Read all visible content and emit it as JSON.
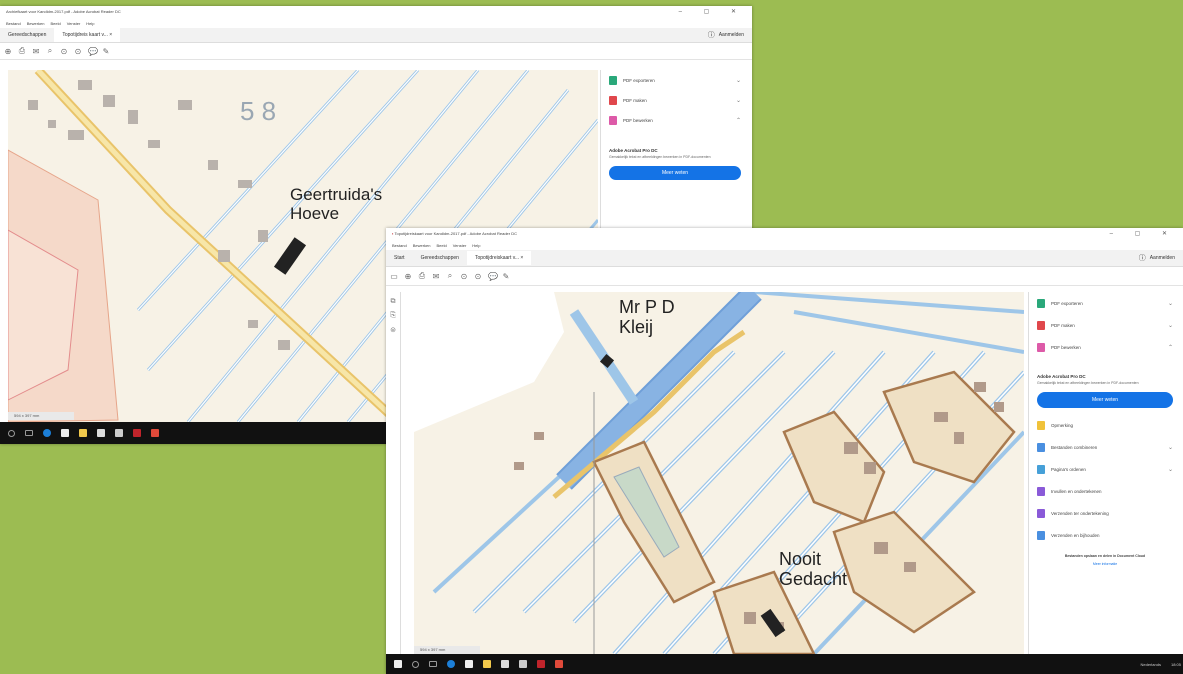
{
  "window1": {
    "title": "Archiefkaart voor Kandidm-2017.pdf - Adobe Acrobat Reader DC",
    "menu": [
      "Bestand",
      "Bewerken",
      "Beeld",
      "Venster",
      "Help"
    ],
    "tabs": [
      "Gereedschappen",
      "Topotijdreis kaart v..."
    ],
    "signin": "Aanmelden",
    "panel": [
      {
        "label": "PDF exporteren",
        "color": "#2aa87a"
      },
      {
        "label": "PDF maken",
        "color": "#e0474c"
      },
      {
        "label": "PDF bewerken",
        "color": "#dd5aa8"
      }
    ],
    "promo_title": "Adobe Acrobat Pro DC",
    "promo_text": "Gemakkelijk tekst en afbeeldingen bewerken in PDF-documenten",
    "promo_button": "Meer weten",
    "map_labels": [
      "Geertruida's",
      "Hoeve"
    ],
    "map_number": "5 8",
    "status": "594 x 397 mm"
  },
  "window2": {
    "title": "Topotijdreiskaart voor Kandidm-2017.pdf - Adobe Acrobat Reader DC",
    "menu": [
      "Bestand",
      "Bewerken",
      "Beeld",
      "Venster",
      "Help"
    ],
    "tabs": [
      "Start",
      "Gereedschappen",
      "Topotijdreiskaart v..."
    ],
    "signin": "Aanmelden",
    "panel": [
      {
        "label": "PDF exporteren",
        "color": "#2aa87a"
      },
      {
        "label": "PDF maken",
        "color": "#e0474c"
      },
      {
        "label": "PDF bewerken",
        "color": "#dd5aa8"
      }
    ],
    "promo_title": "Adobe Acrobat Pro DC",
    "promo_text": "Gemakkelijk tekst en afbeeldingen bewerken in PDF-documenten",
    "promo_button": "Meer weten",
    "tools": [
      {
        "label": "Opmerking",
        "color": "#f0c23a"
      },
      {
        "label": "Bestanden combineren",
        "color": "#4a8fe0"
      },
      {
        "label": "Pagina's ordenen",
        "color": "#46a0d8"
      },
      {
        "label": "Invullen en ondertekenen",
        "color": "#8a5ad8"
      },
      {
        "label": "Verzenden ter ondertekening",
        "color": "#8a5ad8"
      },
      {
        "label": "Verzenden en bijhouden",
        "color": "#4a8fe0"
      }
    ],
    "footer_note": "Bestanden opslaan en delen in Document Cloud",
    "footer_link": "Meer informatie",
    "map_labels": {
      "top": [
        "Mr P D",
        "Kleij"
      ],
      "bottom": [
        "Nooit",
        "Gedacht"
      ]
    },
    "status": "594 x 397 mm",
    "tray_lang": "Nederlands",
    "clock": "18:05"
  }
}
